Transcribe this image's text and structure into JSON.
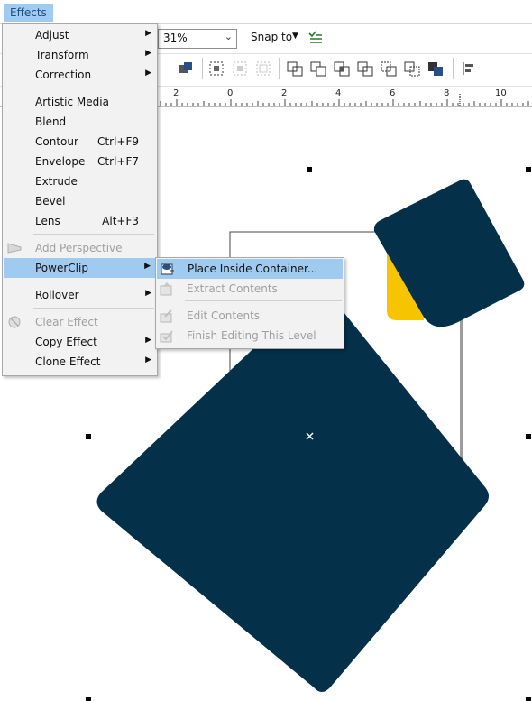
{
  "menubar": {
    "effects_label": "Effects"
  },
  "toolbar": {
    "zoom_value": "31%",
    "snap_label": "Snap to"
  },
  "ruler": {
    "ticks": [
      "2",
      "0",
      "2",
      "4",
      "6",
      "8",
      "10"
    ]
  },
  "effects_menu": {
    "items": [
      {
        "label": "Adjust",
        "submenu": true
      },
      {
        "label": "Transform",
        "submenu": true
      },
      {
        "label": "Correction",
        "submenu": true
      },
      {
        "label": "Artistic Media"
      },
      {
        "label": "Blend"
      },
      {
        "label": "Contour",
        "shortcut": "Ctrl+F9"
      },
      {
        "label": "Envelope",
        "shortcut": "Ctrl+F7"
      },
      {
        "label": "Extrude"
      },
      {
        "label": "Bevel"
      },
      {
        "label": "Lens",
        "shortcut": "Alt+F3"
      },
      {
        "label": "Add Perspective",
        "disabled": true
      },
      {
        "label": "PowerClip",
        "submenu": true,
        "highlighted": true
      },
      {
        "label": "Rollover",
        "submenu": true
      },
      {
        "label": "Clear Effect",
        "disabled": true
      },
      {
        "label": "Copy Effect",
        "submenu": true
      },
      {
        "label": "Clone Effect",
        "submenu": true
      }
    ]
  },
  "powerclip_submenu": {
    "items": [
      {
        "label": "Place Inside Container...",
        "highlighted": true
      },
      {
        "label": "Extract Contents",
        "disabled": true
      },
      {
        "label": "Edit Contents",
        "disabled": true
      },
      {
        "label": "Finish Editing This Level",
        "disabled": true
      }
    ]
  },
  "colors": {
    "navy_shape": "#04304a",
    "yellow_shape": "#f6c400",
    "menu_highlight": "#9fcbf1"
  }
}
